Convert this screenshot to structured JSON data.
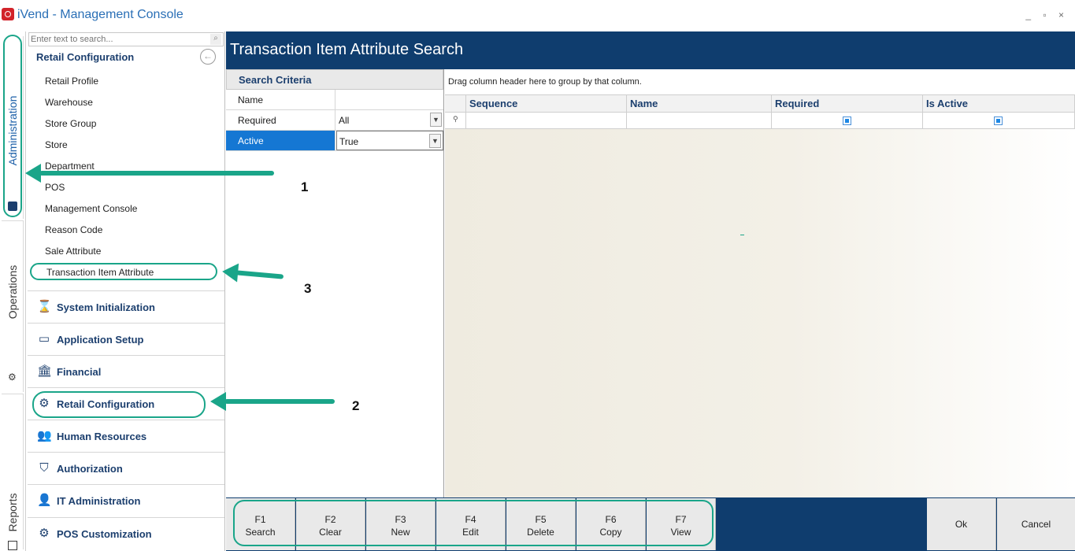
{
  "window": {
    "title": "iVend - Management Console",
    "controls": "_ ▫ ×"
  },
  "left_tabs": {
    "administration": "Administration",
    "operations": "Operations",
    "reports": "Reports"
  },
  "nav": {
    "search_placeholder": "Enter text to search...",
    "section_title": "Retail Configuration",
    "items": [
      "Retail Profile",
      "Warehouse",
      "Store Group",
      "Store",
      "Department",
      "POS",
      "Management Console",
      "Reason Code",
      "Sale Attribute",
      "Transaction Item Attribute"
    ],
    "groups": [
      {
        "label": "System Initialization",
        "icon": "hourglass-icon"
      },
      {
        "label": "Application Setup",
        "icon": "terminal-icon"
      },
      {
        "label": "Financial",
        "icon": "bank-icon"
      },
      {
        "label": "Retail Configuration",
        "icon": "gears-icon"
      },
      {
        "label": "Human Resources",
        "icon": "user-search-icon"
      },
      {
        "label": "Authorization",
        "icon": "shield-icon"
      },
      {
        "label": "IT Administration",
        "icon": "user-admin-icon"
      },
      {
        "label": "POS Customization",
        "icon": "pos-config-icon"
      }
    ]
  },
  "main": {
    "title": "Transaction Item Attribute Search",
    "criteria": {
      "header": "Search Criteria",
      "rows": [
        {
          "label": "Name",
          "value": ""
        },
        {
          "label": "Required",
          "value": "All"
        },
        {
          "label": "Active",
          "value": "True"
        }
      ]
    },
    "grid": {
      "group_hint": "Drag column header here to group by that column.",
      "columns": [
        "Sequence",
        "Name",
        "Required",
        "Is Active"
      ]
    }
  },
  "function_bar": {
    "buttons": [
      {
        "key": "F1",
        "label": "Search"
      },
      {
        "key": "F2",
        "label": "Clear"
      },
      {
        "key": "F3",
        "label": "New"
      },
      {
        "key": "F4",
        "label": "Edit"
      },
      {
        "key": "F5",
        "label": "Delete"
      },
      {
        "key": "F6",
        "label": "Copy"
      },
      {
        "key": "F7",
        "label": "View"
      }
    ],
    "ok": "Ok",
    "cancel": "Cancel"
  },
  "annotations": {
    "n1": "1",
    "n2": "2",
    "n3": "3"
  },
  "colors": {
    "brand_navy": "#0f3d6e",
    "annotation_teal": "#1aa589",
    "selection_blue": "#1577d3"
  }
}
